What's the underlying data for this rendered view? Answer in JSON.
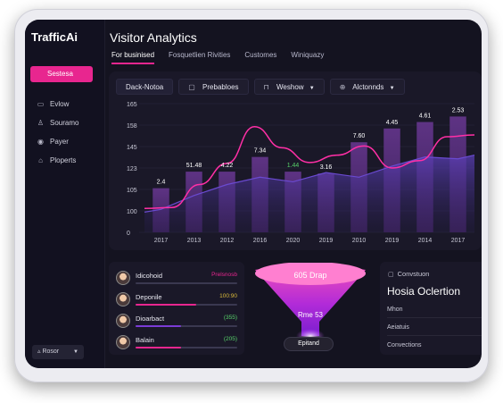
{
  "app": {
    "brand": "TrafficAi",
    "title": "Visitor Analytics"
  },
  "tabs": [
    "For businised",
    "Fosquetlien Rivities",
    "Customes",
    "Winiquazy"
  ],
  "sidebar": {
    "active": {
      "label": "Sestesa",
      "icon": "circle-icon"
    },
    "items": [
      {
        "label": "Evlow",
        "icon": "grid-icon"
      },
      {
        "label": "Souramo",
        "icon": "user-icon"
      },
      {
        "label": "Payer",
        "icon": "eye-icon"
      },
      {
        "label": "Ploperts",
        "icon": "home-icon"
      }
    ],
    "footer": {
      "label": "Rosor",
      "icon": "drop-icon"
    }
  },
  "toolbar": {
    "first": "Dack-Notoa",
    "items": [
      {
        "label": "Prebabloes",
        "icon": "calendar-icon"
      },
      {
        "label": "Weshow",
        "icon": "lock-icon"
      },
      {
        "label": "Alctonnds",
        "icon": "filter-icon"
      }
    ]
  },
  "chart_data": {
    "type": "bar",
    "categories": [
      "2017",
      "2013",
      "2012",
      "2016",
      "2020",
      "2019",
      "2010",
      "2019",
      "2014",
      "2017"
    ],
    "yticks": [
      "165",
      "158",
      "145",
      "123",
      "105",
      "100",
      "0"
    ],
    "bar_labels": [
      "2.4",
      "51.48",
      "4.22",
      "7.34",
      "1.44",
      "3.16",
      "7.60",
      "4.45",
      "4.61",
      "2.53"
    ],
    "bar_values": [
      48,
      66,
      66,
      82,
      66,
      64,
      98,
      113,
      120,
      126
    ],
    "line_values": [
      25,
      40,
      52,
      60,
      55,
      65,
      60,
      72,
      82,
      80
    ],
    "curve_values": [
      26,
      27,
      52,
      75,
      115,
      92,
      76,
      84,
      94,
      70,
      78,
      104,
      106
    ],
    "colors": {
      "bar": "#4a2b6e",
      "line": "#5b3fb8",
      "curve": "#ff2fa6",
      "label_highlight": "#57d26a"
    }
  },
  "list": {
    "header": {
      "name": "Idicohoid",
      "value": "Prelsnosb"
    },
    "rows": [
      {
        "name": "Deponile",
        "value": "100:90",
        "fill": 0.6,
        "color": "#d9b93a",
        "barcolor": "#e8268f"
      },
      {
        "name": "Dioarbact",
        "value": "(355)",
        "fill": 0.45,
        "color": "#57d26a",
        "barcolor": "#7b3bd6"
      },
      {
        "name": "Balain",
        "value": "(205)",
        "fill": 0.45,
        "color": "#57d26a",
        "barcolor": "#e8268f"
      }
    ]
  },
  "funnel": {
    "top": "605 Drap",
    "middle": "Rme 53",
    "bottom": "Epitand"
  },
  "right_panel": {
    "head": "Convstuon",
    "title": "Hosia Oclertion",
    "items": [
      "Mhon",
      "Aeiatuis",
      "Convections"
    ]
  }
}
